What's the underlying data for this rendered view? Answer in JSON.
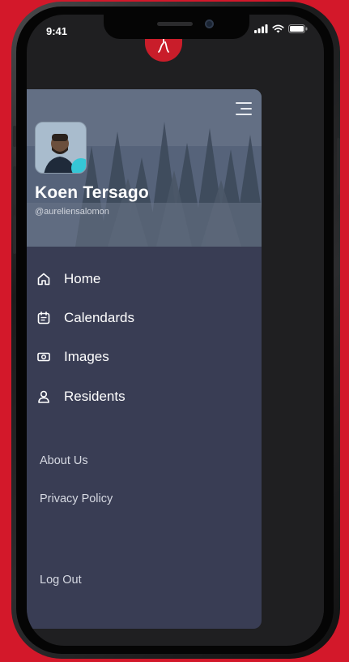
{
  "status_bar": {
    "time": "9:41",
    "icons": [
      "signal-icon",
      "wifi-icon",
      "battery-icon"
    ]
  },
  "app": {
    "logo_icon": "brand-logo-icon",
    "brand_color": "#c91d2a"
  },
  "drawer": {
    "menu_icon": "menu-icon",
    "profile": {
      "name": "Koen Tersago",
      "handle": "@aureliensalomon"
    },
    "nav_items": [
      {
        "label": "Home",
        "icon": "home-icon"
      },
      {
        "label": "Calendards",
        "icon": "calendar-icon"
      },
      {
        "label": "Images",
        "icon": "image-icon"
      },
      {
        "label": "Residents",
        "icon": "user-icon"
      }
    ],
    "secondary_links": [
      {
        "label": "About Us"
      },
      {
        "label": "Privacy Policy"
      }
    ],
    "logout_label": "Log Out"
  },
  "colors": {
    "background": "#d3182a",
    "drawer": "#393d54",
    "screen": "#1f1f21"
  }
}
